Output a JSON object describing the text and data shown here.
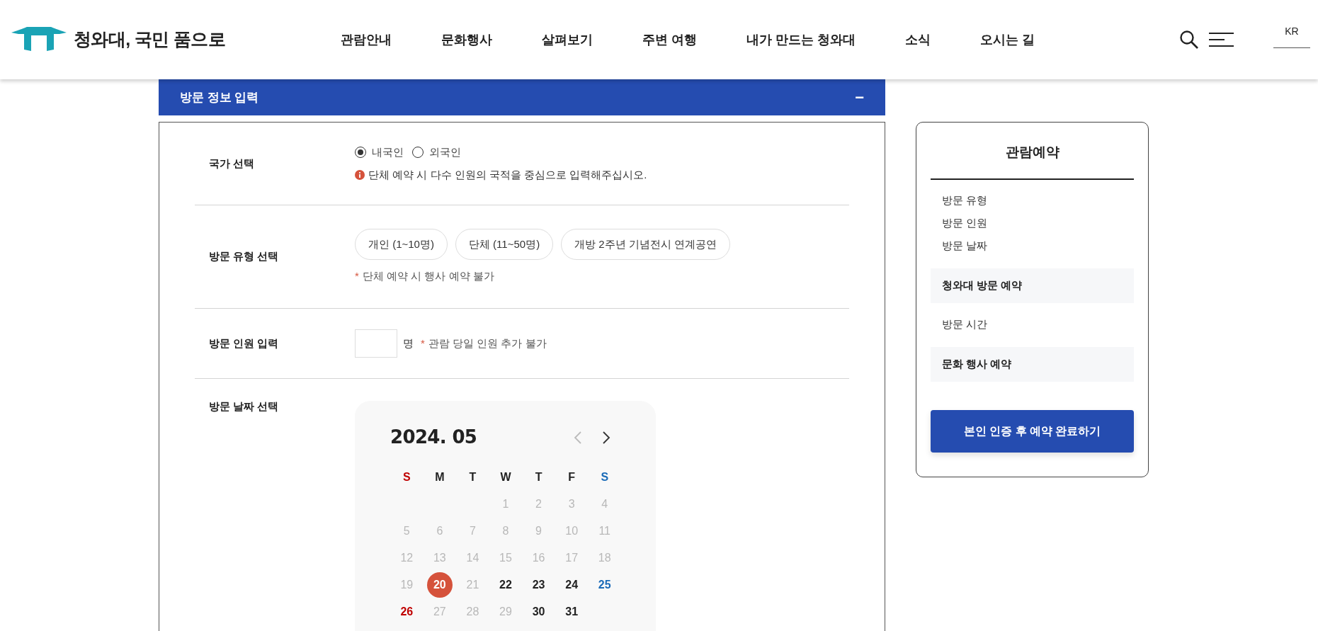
{
  "header": {
    "logo_text": "청와대, 국민 품으로",
    "nav": [
      "관람안내",
      "문화행사",
      "살펴보기",
      "주변 여행",
      "내가 만드는 청와대",
      "소식",
      "오시는 길"
    ],
    "language": "KR"
  },
  "section": {
    "title": "방문 정보 입력",
    "toggle": "−",
    "expanded": true
  },
  "form": {
    "nation": {
      "label": "국가 선택",
      "options": [
        {
          "label": "내국인",
          "selected": true
        },
        {
          "label": "외국인",
          "selected": false
        }
      ],
      "info": "단체 예약 시 다수 인원의 국적을 중심으로 입력해주십시오."
    },
    "visit_type": {
      "label": "방문 유형 선택",
      "options": [
        "개인 (1~10명)",
        "단체 (11~50명)",
        "개방 2주년 기념전시 연계공연"
      ],
      "note_mark": "*",
      "note": "단체 예약 시 행사 예약 불가"
    },
    "people": {
      "label": "방문 인원 입력",
      "unit": "명",
      "note_mark": "*",
      "note": "관람 당일 인원 추가 불가"
    },
    "date": {
      "label": "방문 날짜 선택",
      "calendar": {
        "title": "2024. 05",
        "prev": {
          "disabled": true
        },
        "next": {
          "disabled": false
        },
        "weekdays": [
          {
            "label": "S",
            "color": "#c00000"
          },
          {
            "label": "M",
            "color": "#222222"
          },
          {
            "label": "T",
            "color": "#222222"
          },
          {
            "label": "W",
            "color": "#222222"
          },
          {
            "label": "T",
            "color": "#222222"
          },
          {
            "label": "F",
            "color": "#222222"
          },
          {
            "label": "S",
            "color": "#1a6bb8"
          }
        ],
        "weeks": [
          [
            {
              "kind": "blank"
            },
            {
              "kind": "blank"
            },
            {
              "kind": "blank"
            },
            {
              "day": "1",
              "kind": "past"
            },
            {
              "day": "2",
              "kind": "past"
            },
            {
              "day": "3",
              "kind": "past"
            },
            {
              "day": "4",
              "kind": "past"
            }
          ],
          [
            {
              "day": "5",
              "kind": "past"
            },
            {
              "day": "6",
              "kind": "past"
            },
            {
              "day": "7",
              "kind": "past"
            },
            {
              "day": "8",
              "kind": "past"
            },
            {
              "day": "9",
              "kind": "past"
            },
            {
              "day": "10",
              "kind": "past"
            },
            {
              "day": "11",
              "kind": "past"
            }
          ],
          [
            {
              "day": "12",
              "kind": "past"
            },
            {
              "day": "13",
              "kind": "past"
            },
            {
              "day": "14",
              "kind": "past"
            },
            {
              "day": "15",
              "kind": "past"
            },
            {
              "day": "16",
              "kind": "past"
            },
            {
              "day": "17",
              "kind": "past"
            },
            {
              "day": "18",
              "kind": "past"
            }
          ],
          [
            {
              "day": "19",
              "kind": "past"
            },
            {
              "day": "20",
              "kind": "selected"
            },
            {
              "day": "21",
              "kind": "past"
            },
            {
              "day": "22",
              "kind": "open"
            },
            {
              "day": "23",
              "kind": "open"
            },
            {
              "day": "24",
              "kind": "open"
            },
            {
              "day": "25",
              "kind": "open"
            }
          ],
          [
            {
              "day": "26",
              "kind": "open"
            },
            {
              "day": "27",
              "kind": "past"
            },
            {
              "day": "28",
              "kind": "past"
            },
            {
              "day": "29",
              "kind": "past"
            },
            {
              "day": "30",
              "kind": "open"
            },
            {
              "day": "31",
              "kind": "open"
            },
            {
              "kind": "blank"
            }
          ]
        ]
      }
    }
  },
  "summary": {
    "title": "관람예약",
    "items": [
      {
        "label": "방문 유형",
        "kind": "plain"
      },
      {
        "label": "방문 인원",
        "kind": "plain"
      },
      {
        "label": "방문 날짜",
        "kind": "plain"
      },
      {
        "label": "청와대 방문 예약",
        "kind": "section"
      },
      {
        "label": "방문 시간",
        "kind": "plain"
      },
      {
        "label": "문화 행사 예약",
        "kind": "section"
      }
    ],
    "button": "본인 인증 후 예약 완료하기"
  }
}
